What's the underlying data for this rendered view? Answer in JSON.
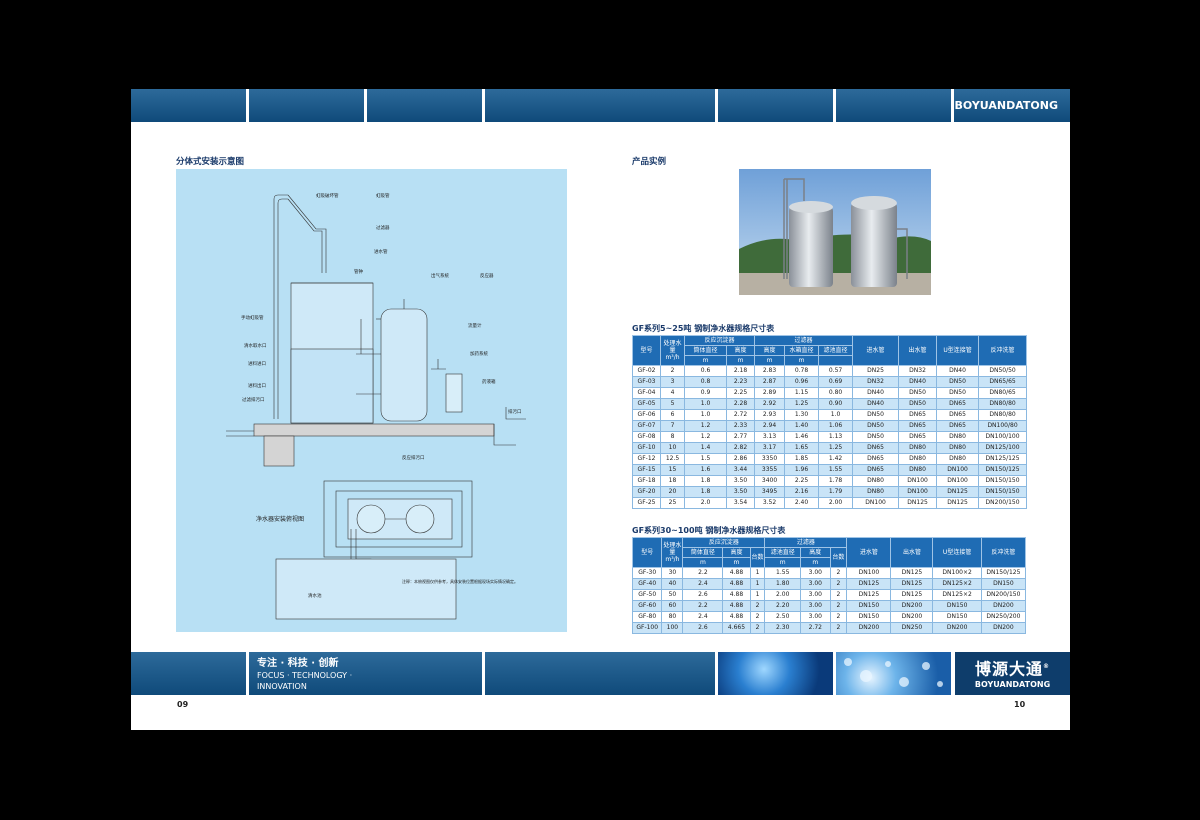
{
  "brand": {
    "name_en": "BOYUANDATONG",
    "name_cn": "博源大通",
    "registered": "®"
  },
  "left": {
    "section_title": "分体式安装示意图",
    "page_number": "09",
    "slogan": {
      "cn": "专注 · 科技 · 创新",
      "en1": "FOCUS · TECHNOLOGY ·",
      "en2": "INNOVATION"
    },
    "diagram_labels": {
      "siphon_breaker": "虹吸破坏管",
      "siphon_pipe": "虹吸管",
      "filter": "过滤器",
      "inlet_pipe": "进水管",
      "bell": "管钟",
      "exhaust": "出气系统",
      "reactor": "反应器",
      "manual_siphon": "手动虹吸管",
      "clear_water_outlet": "清水取水口",
      "feed_inlet": "进料进口",
      "feed_outlet": "进料出口",
      "filter_drain": "过滤排污口",
      "flow_meter": "流量计",
      "dosing_system": "加药系统",
      "dosing_tank": "药液箱",
      "reactor_drain": "反应排污口",
      "drain_outlet": "排污口",
      "plan_view": "净水器安装俯视图",
      "water_tank": "清水池",
      "note": "注释：本俯视图仅供参考，具体安装位置根据现场实际情况确定。"
    }
  },
  "right": {
    "section_title": "产品实例",
    "page_number": "10",
    "table1": {
      "title": "GF系列5~25吨 钢制净水器规格尺寸表",
      "headers": {
        "model": "型号",
        "capacity": "处理水量",
        "capacity_unit": "m³/h",
        "reactor": "反应沉淀器",
        "filter": "过滤器",
        "diameter": "筒体直径",
        "height": "高度",
        "unit_m": "m",
        "tank_diameter": "水箱直径",
        "filter_diameter": "滤池直径",
        "inlet": "进水管",
        "outlet": "出水管",
        "u_pipe": "U型连接管",
        "backwash": "反冲洗管"
      },
      "rows": [
        [
          "GF-02",
          "2",
          "0.6",
          "2.18",
          "2.83",
          "0.78",
          "0.57",
          "DN25",
          "DN32",
          "DN40",
          "DN50/50"
        ],
        [
          "GF-03",
          "3",
          "0.8",
          "2.23",
          "2.87",
          "0.96",
          "0.69",
          "DN32",
          "DN40",
          "DN50",
          "DN65/65"
        ],
        [
          "GF-04",
          "4",
          "0.9",
          "2.25",
          "2.89",
          "1.15",
          "0.80",
          "DN40",
          "DN50",
          "DN50",
          "DN80/65"
        ],
        [
          "GF-05",
          "5",
          "1.0",
          "2.28",
          "2.92",
          "1.25",
          "0.90",
          "DN40",
          "DN50",
          "DN65",
          "DN80/80"
        ],
        [
          "GF-06",
          "6",
          "1.0",
          "2.72",
          "2.93",
          "1.30",
          "1.0",
          "DN50",
          "DN65",
          "DN65",
          "DN80/80"
        ],
        [
          "GF-07",
          "7",
          "1.2",
          "2.33",
          "2.94",
          "1.40",
          "1.06",
          "DN50",
          "DN65",
          "DN65",
          "DN100/80"
        ],
        [
          "GF-08",
          "8",
          "1.2",
          "2.77",
          "3.13",
          "1.46",
          "1.13",
          "DN50",
          "DN65",
          "DN80",
          "DN100/100"
        ],
        [
          "GF-10",
          "10",
          "1.4",
          "2.82",
          "3.17",
          "1.65",
          "1.25",
          "DN65",
          "DN80",
          "DN80",
          "DN125/100"
        ],
        [
          "GF-12",
          "12.5",
          "1.5",
          "2.86",
          "3350",
          "1.85",
          "1.42",
          "DN65",
          "DN80",
          "DN80",
          "DN125/125"
        ],
        [
          "GF-15",
          "15",
          "1.6",
          "3.44",
          "3355",
          "1.96",
          "1.55",
          "DN65",
          "DN80",
          "DN100",
          "DN150/125"
        ],
        [
          "GF-18",
          "18",
          "1.8",
          "3.50",
          "3400",
          "2.25",
          "1.78",
          "DN80",
          "DN100",
          "DN100",
          "DN150/150"
        ],
        [
          "GF-20",
          "20",
          "1.8",
          "3.50",
          "3495",
          "2.16",
          "1.79",
          "DN80",
          "DN100",
          "DN125",
          "DN150/150"
        ],
        [
          "GF-25",
          "25",
          "2.0",
          "3.54",
          "3.52",
          "2.40",
          "2.00",
          "DN100",
          "DN125",
          "DN125",
          "DN200/150"
        ]
      ]
    },
    "table2": {
      "title": "GF系列30~100吨 钢制净水器规格尺寸表",
      "headers": {
        "model": "型号",
        "capacity": "处理水量",
        "capacity_unit": "m³/h",
        "reactor": "反应沉淀器",
        "filter": "过滤器",
        "diameter": "筒体直径",
        "height": "高度",
        "unit_m": "m",
        "count": "台数",
        "filter_diameter": "滤池直径",
        "inlet": "进水管",
        "outlet": "出水管",
        "u_pipe": "U型连接管",
        "backwash": "反冲洗管"
      },
      "rows": [
        [
          "GF-30",
          "30",
          "2.2",
          "4.88",
          "1",
          "1.55",
          "3.00",
          "2",
          "DN100",
          "DN125",
          "DN100×2",
          "DN150/125"
        ],
        [
          "GF-40",
          "40",
          "2.4",
          "4.88",
          "1",
          "1.80",
          "3.00",
          "2",
          "DN125",
          "DN125",
          "DN125×2",
          "DN150"
        ],
        [
          "GF-50",
          "50",
          "2.6",
          "4.88",
          "1",
          "2.00",
          "3.00",
          "2",
          "DN125",
          "DN125",
          "DN125×2",
          "DN200/150"
        ],
        [
          "GF-60",
          "60",
          "2.2",
          "4.88",
          "2",
          "2.20",
          "3.00",
          "2",
          "DN150",
          "DN200",
          "DN150",
          "DN200"
        ],
        [
          "GF-80",
          "80",
          "2.4",
          "4.88",
          "2",
          "2.50",
          "3.00",
          "2",
          "DN150",
          "DN200",
          "DN150",
          "DN250/200"
        ],
        [
          "GF-100",
          "100",
          "2.6",
          "4.665",
          "2",
          "2.30",
          "2.72",
          "2",
          "DN200",
          "DN250",
          "DN200",
          "DN200"
        ]
      ]
    }
  },
  "colors": {
    "band": "#1a5a8f",
    "table_header": "#1f6cb4",
    "row_alt": "#c9e4f7",
    "diagram_bg": "#b8e0f4"
  }
}
